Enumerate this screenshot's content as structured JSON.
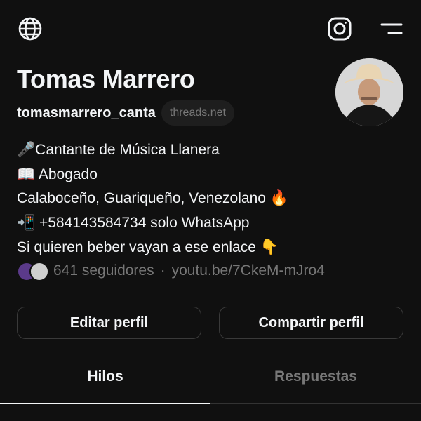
{
  "header": {
    "globe_icon": "globe-icon",
    "instagram_icon": "instagram-icon",
    "menu_icon": "menu-icon"
  },
  "profile": {
    "name": "Tomas Marrero",
    "handle": "tomasmarrero_canta",
    "domain_badge": "threads.net",
    "bio": [
      "🎤Cantante de Música Llanera",
      "📖 Abogado",
      "Calaboceño, Guariqueño, Venezolano 🔥",
      "📲 +584143584734 solo WhatsApp",
      "Si quieren beber vayan a ese enlace 👇"
    ],
    "followers": "641 seguidores",
    "link": "youtu.be/7CkeM-mJro4"
  },
  "actions": {
    "edit_label": "Editar perfil",
    "share_label": "Compartir perfil"
  },
  "tabs": [
    {
      "label": "Hilos",
      "active": true
    },
    {
      "label": "Respuestas",
      "active": false
    }
  ],
  "colors": {
    "background": "#101010",
    "text": "#f3f5f7",
    "muted": "#777777"
  }
}
